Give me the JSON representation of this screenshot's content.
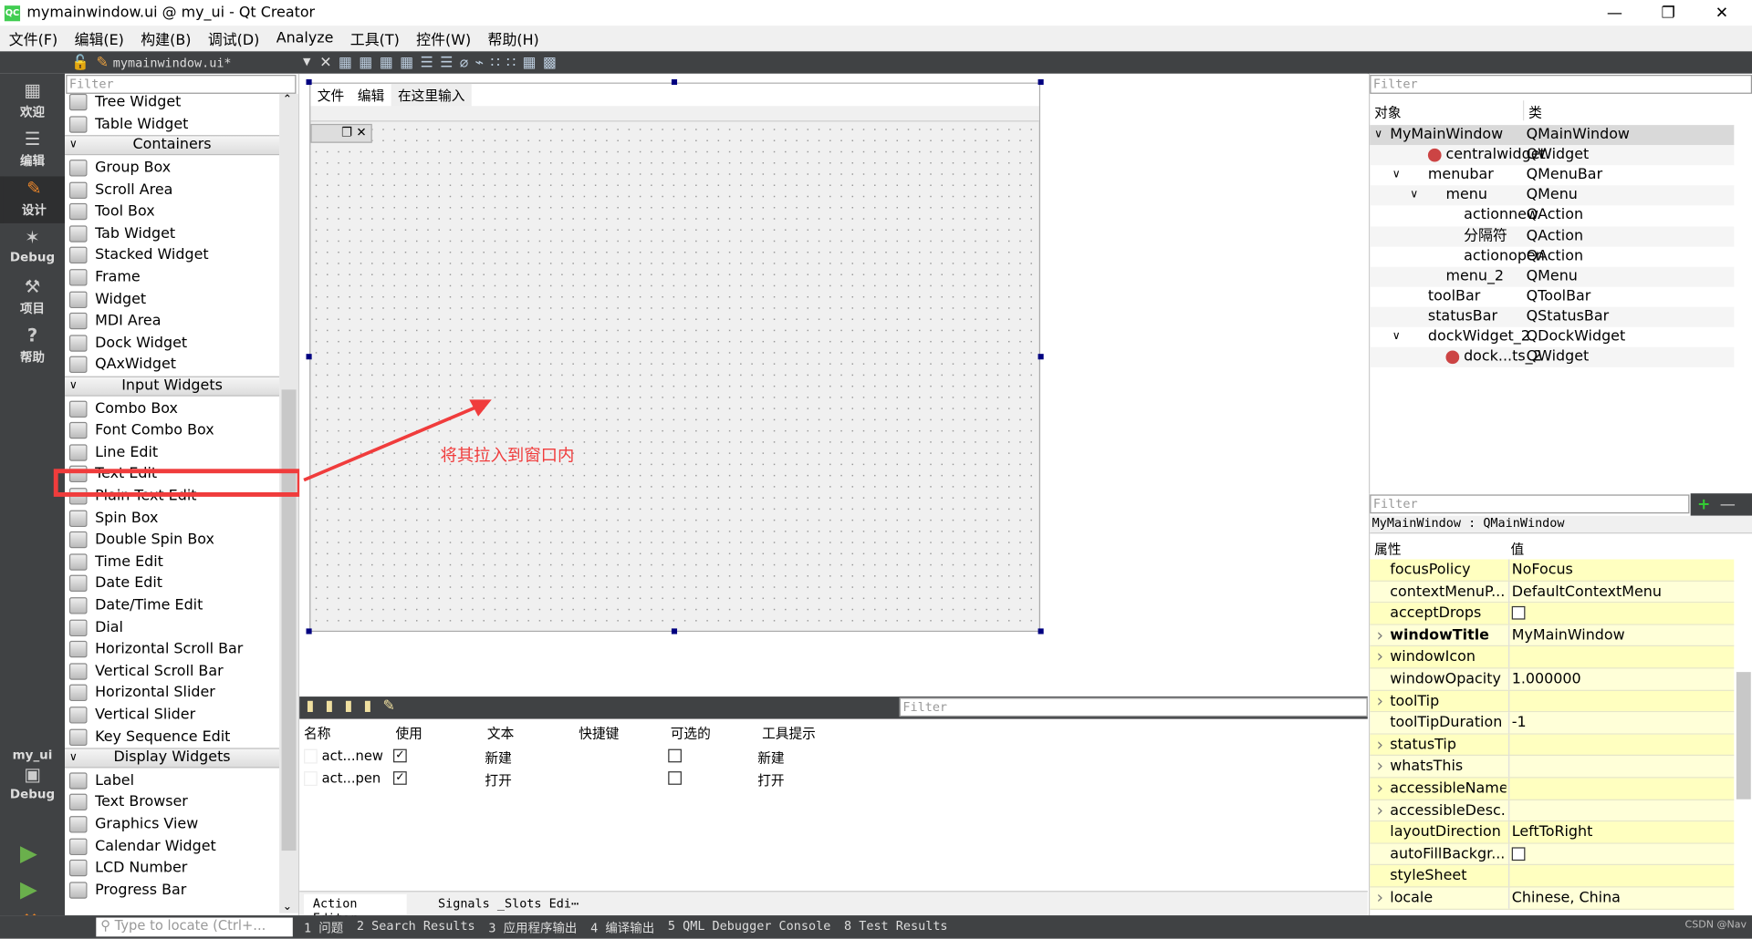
{
  "window": {
    "title": "mymainwindow.ui @ my_ui - Qt Creator",
    "logo": "QC"
  },
  "menu": [
    "文件(F)",
    "编辑(E)",
    "构建(B)",
    "调试(D)",
    "Analyze",
    "工具(T)",
    "控件(W)",
    "帮助(H)"
  ],
  "toolbar": {
    "file": "mymainwindow.ui*"
  },
  "modes": [
    {
      "label": "欢迎",
      "icon": "grid-icon"
    },
    {
      "label": "编辑",
      "icon": "document-icon"
    },
    {
      "label": "设计",
      "icon": "pencil-icon"
    },
    {
      "label": "Debug",
      "icon": "bug-icon"
    },
    {
      "label": "项目",
      "icon": "wrench-icon"
    },
    {
      "label": "帮助",
      "icon": "help-icon"
    }
  ],
  "kit": {
    "project": "my_ui",
    "mode": "Debug"
  },
  "widgetbox": {
    "filter_placeholder": "Filter",
    "items": [
      {
        "type": "item",
        "label": "Tree Widget"
      },
      {
        "type": "item",
        "label": "Table Widget"
      },
      {
        "type": "cat",
        "label": "Containers"
      },
      {
        "type": "item",
        "label": "Group Box"
      },
      {
        "type": "item",
        "label": "Scroll Area"
      },
      {
        "type": "item",
        "label": "Tool Box"
      },
      {
        "type": "item",
        "label": "Tab Widget"
      },
      {
        "type": "item",
        "label": "Stacked Widget"
      },
      {
        "type": "item",
        "label": "Frame"
      },
      {
        "type": "item",
        "label": "Widget"
      },
      {
        "type": "item",
        "label": "MDI Area"
      },
      {
        "type": "item",
        "label": "Dock Widget"
      },
      {
        "type": "item",
        "label": "QAxWidget"
      },
      {
        "type": "cat",
        "label": "Input Widgets"
      },
      {
        "type": "item",
        "label": "Combo Box"
      },
      {
        "type": "item",
        "label": "Font Combo Box"
      },
      {
        "type": "item",
        "label": "Line Edit"
      },
      {
        "type": "item",
        "label": "Text Edit",
        "highlight": true
      },
      {
        "type": "item",
        "label": "Plain Text Edit"
      },
      {
        "type": "item",
        "label": "Spin Box"
      },
      {
        "type": "item",
        "label": "Double Spin Box"
      },
      {
        "type": "item",
        "label": "Time Edit"
      },
      {
        "type": "item",
        "label": "Date Edit"
      },
      {
        "type": "item",
        "label": "Date/Time Edit"
      },
      {
        "type": "item",
        "label": "Dial"
      },
      {
        "type": "item",
        "label": "Horizontal Scroll Bar"
      },
      {
        "type": "item",
        "label": "Vertical Scroll Bar"
      },
      {
        "type": "item",
        "label": "Horizontal Slider"
      },
      {
        "type": "item",
        "label": "Vertical Slider"
      },
      {
        "type": "item",
        "label": "Key Sequence Edit"
      },
      {
        "type": "cat",
        "label": "Display Widgets"
      },
      {
        "type": "item",
        "label": "Label"
      },
      {
        "type": "item",
        "label": "Text Browser"
      },
      {
        "type": "item",
        "label": "Graphics View"
      },
      {
        "type": "item",
        "label": "Calendar Widget"
      },
      {
        "type": "item",
        "label": "LCD Number"
      },
      {
        "type": "item",
        "label": "Progress Bar"
      }
    ]
  },
  "form": {
    "menus": [
      "文件",
      "编辑",
      "在这里输入"
    ],
    "annotation": "将其拉入到窗口内",
    "annotation_color": "#f03c3c"
  },
  "action_editor": {
    "filter_placeholder": "Filter",
    "headers": [
      "名称",
      "使用",
      "文本",
      "快捷键",
      "可选的",
      "工具提示"
    ],
    "rows": [
      {
        "name": "act...new",
        "used": true,
        "text": "新建",
        "shortcut": "",
        "checkable": false,
        "tooltip": "新建"
      },
      {
        "name": "act...pen",
        "used": true,
        "text": "打开",
        "shortcut": "",
        "checkable": false,
        "tooltip": "打开"
      }
    ],
    "tabs": [
      "Action Editor",
      "Signals _Slots Edi⋯"
    ]
  },
  "object_inspector": {
    "filter_placeholder": "Filter",
    "headers": [
      "对象",
      "类"
    ],
    "rows": [
      {
        "name": "MyMainWindow",
        "class": "QMainWindow",
        "level": 0,
        "expanded": true,
        "selected": true
      },
      {
        "name": "centralwidget",
        "class": "QWidget",
        "level": 1,
        "icon": true
      },
      {
        "name": "menubar",
        "class": "QMenuBar",
        "level": 1,
        "expanded": true
      },
      {
        "name": "menu",
        "class": "QMenu",
        "level": 2,
        "expanded": true
      },
      {
        "name": "actionnew",
        "class": "QAction",
        "level": 3
      },
      {
        "name": "分隔符",
        "class": "QAction",
        "level": 3
      },
      {
        "name": "actionopen",
        "class": "QAction",
        "level": 3
      },
      {
        "name": "menu_2",
        "class": "QMenu",
        "level": 2
      },
      {
        "name": "toolBar",
        "class": "QToolBar",
        "level": 1
      },
      {
        "name": "statusBar",
        "class": "QStatusBar",
        "level": 1
      },
      {
        "name": "dockWidget_2",
        "class": "QDockWidget",
        "level": 1,
        "expanded": true
      },
      {
        "name": "dock...ts_2",
        "class": "QWidget",
        "level": 2,
        "icon": true
      }
    ]
  },
  "property_editor": {
    "filter_placeholder": "Filter",
    "context": "MyMainWindow : QMainWindow",
    "headers": [
      "属性",
      "值"
    ],
    "rows": [
      {
        "name": "focusPolicy",
        "value": "NoFocus"
      },
      {
        "name": "contextMenuP...",
        "value": "DefaultContextMenu"
      },
      {
        "name": "acceptDrops",
        "checkbox": false
      },
      {
        "name": "windowTitle",
        "value": "MyMainWindow",
        "bold": true,
        "expandable": true
      },
      {
        "name": "windowIcon",
        "value": "",
        "expandable": true
      },
      {
        "name": "windowOpacity",
        "value": "1.000000"
      },
      {
        "name": "toolTip",
        "value": "",
        "expandable": true
      },
      {
        "name": "toolTipDuration",
        "value": "-1"
      },
      {
        "name": "statusTip",
        "value": "",
        "expandable": true
      },
      {
        "name": "whatsThis",
        "value": "",
        "expandable": true
      },
      {
        "name": "accessibleName",
        "value": "",
        "expandable": true
      },
      {
        "name": "accessibleDesc...",
        "value": "",
        "expandable": true
      },
      {
        "name": "layoutDirection",
        "value": "LeftToRight"
      },
      {
        "name": "autoFillBackgr...",
        "checkbox": false
      },
      {
        "name": "styleSheet",
        "value": ""
      },
      {
        "name": "locale",
        "value": "Chinese, China",
        "expandable": true
      }
    ]
  },
  "statusbar": {
    "locate_placeholder": "Type to locate (Ctrl+...",
    "panes": [
      "1 问题",
      "2 Search Results",
      "3 应用程序输出",
      "4 编译输出",
      "5 QML Debugger Console",
      "8 Test Results"
    ],
    "watermark": "CSDN @Nav"
  }
}
